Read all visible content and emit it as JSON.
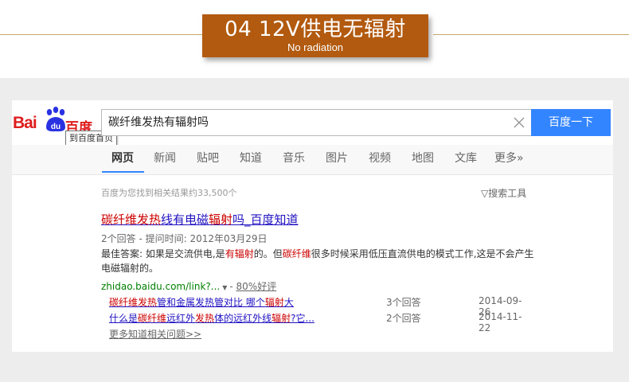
{
  "banner": {
    "title": "04 12V供电无辐射",
    "subtitle": "No radiation"
  },
  "logo": {
    "bai": "Bai",
    "du": "du",
    "cn": "百度"
  },
  "tooltip": "到百度首页",
  "search": {
    "query": "碳纤维发热有辐射吗",
    "button": "百度一下"
  },
  "tabs": [
    "网页",
    "新闻",
    "贴吧",
    "知道",
    "音乐",
    "图片",
    "视频",
    "地图",
    "文库",
    "更多»"
  ],
  "stats": "百度为您找到相关结果约33,500个",
  "tools": "搜索工具",
  "result": {
    "title_em": "碳纤维发热",
    "title_rest": "线有电磁",
    "title_em2": "辐射",
    "title_end": "吗_百度知道",
    "meta": "2个回答 - 提问时间: 2012年03月29日",
    "answer_pre": "最佳答案: 如果是交流供电,是",
    "answer_em1": "有辐射",
    "answer_mid": "的。但",
    "answer_em2": "碳纤维",
    "answer_post": "很多时候采用低压直流供电的模式工作,这是不会产生电磁辐射的。",
    "url": "zhidao.baidu.com/link?...",
    "rating": "80%好评"
  },
  "sub_results": [
    {
      "title_em": "碳纤维发热",
      "title_rest": "管和金属发热管对比 哪个",
      "title_em2": "辐射",
      "title_end": "大",
      "count": "3个回答",
      "date": "2014-09-26"
    },
    {
      "title_pre": "什么是",
      "title_em": "碳纤维",
      "title_mid": "远红外",
      "title_em2": "发热",
      "title_mid2": "体的远红外线",
      "title_em3": "辐射",
      "title_end": "?它...",
      "count": "2个回答",
      "date": "2014-11-22"
    }
  ],
  "more": "更多知道相关问题>>",
  "colors": {
    "banner": "#b25a0f",
    "brand_red": "#de1d1d",
    "brand_blue": "#2932e1",
    "button": "#3385ff",
    "link": "#2011c1",
    "emphasis": "#cc0000",
    "url_green": "#008000"
  }
}
